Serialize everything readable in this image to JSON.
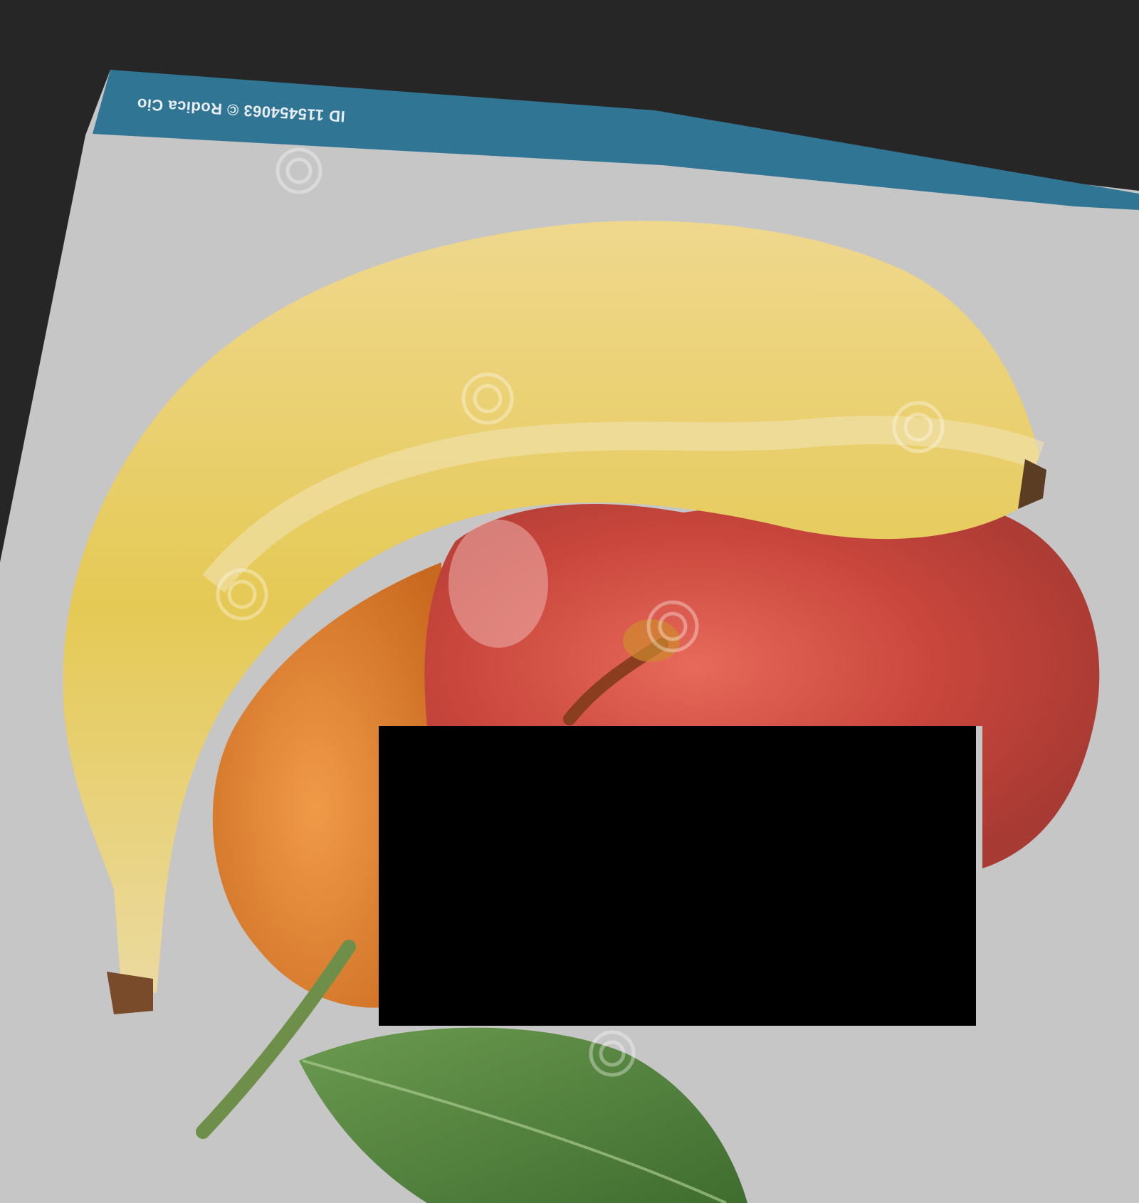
{
  "photo": {
    "subject": "banana-apple-orange-with-leaf",
    "credit_text": "ID 115454063 © Rodica Cio",
    "watermark": "dreamstime",
    "colors": {
      "background": "#262626",
      "paper": "#c6c6c6",
      "banner": "#307594",
      "banana": "#e9cf72",
      "apple": "#c9463c",
      "orange": "#dc7a2e",
      "leaf": "#4f7f3a"
    },
    "icons": {
      "watermark_logo": "dreamstime-spiral-icon"
    }
  }
}
